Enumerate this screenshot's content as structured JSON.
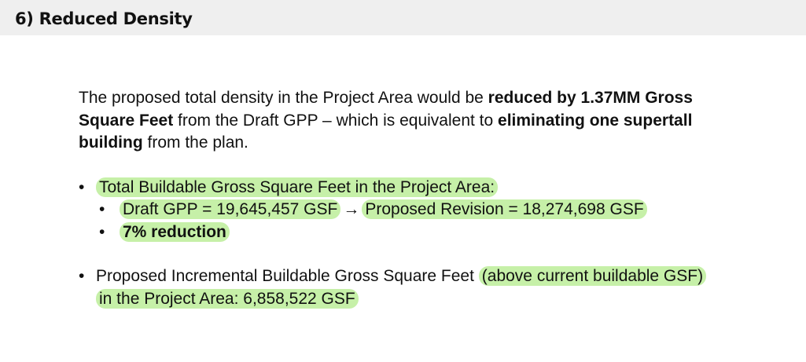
{
  "header": {
    "title": "6) Reduced Density"
  },
  "intro": {
    "part1": "The proposed total density in the Project Area would be ",
    "bold1": "reduced by 1.37MM Gross Square Feet",
    "part2": " from the Draft GPP – which is equivalent to ",
    "bold2": "eliminating one supertall building",
    "part3": " from the plan."
  },
  "bullets": {
    "symbol": "•",
    "item1": {
      "label": "Total Buildable Gross Square Feet in the Project Area:",
      "sub1_a": "Draft GPP = 19,645,457 GSF",
      "arrow": "→",
      "sub1_b": "Proposed Revision = 18,274,698 GSF",
      "sub2": "7% reduction"
    },
    "item2": {
      "label_a": "Proposed Incremental Buildable Gross Square Feet",
      "label_b": "(above current buildable GSF) in the Project Area:  6,858,522 GSF"
    }
  },
  "colors": {
    "highlight": "#c6f0a8",
    "header_bg": "#efefef"
  }
}
